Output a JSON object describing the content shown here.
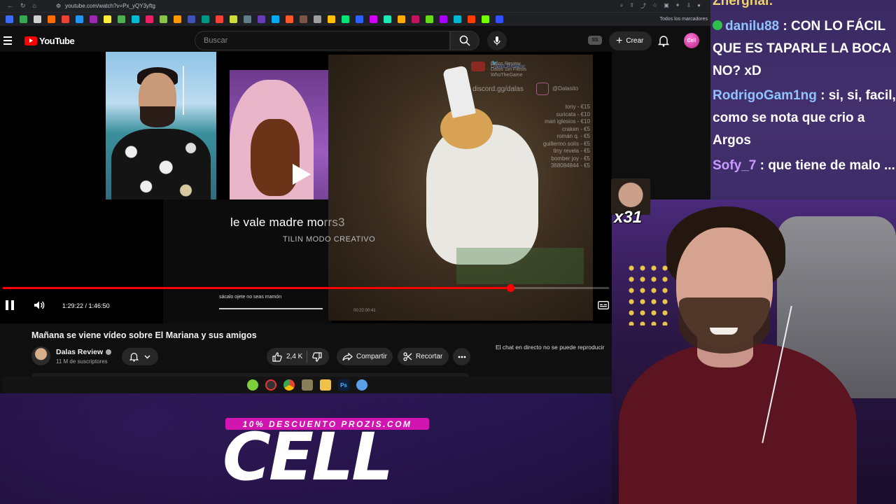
{
  "browser": {
    "url": "youtube.com/watch?v=Px_yQY3yftg",
    "bookmarks_all_label": "Todos los marcadores",
    "bookmark_colors": [
      "#3c6cf6",
      "#34a853",
      "#cfcfcf",
      "#ff6d00",
      "#ea4335",
      "#2196f3",
      "#9c27b0",
      "#ffeb3b",
      "#4caf50",
      "#00bcd4",
      "#e91e63",
      "#8bc34a",
      "#ff9800",
      "#3f51b5",
      "#009688",
      "#f44336",
      "#cddc39",
      "#607d8b",
      "#673ab7",
      "#03a9f4",
      "#ff5722",
      "#795548",
      "#9e9e9e",
      "#ffc107",
      "#00e676",
      "#2962ff",
      "#d500f9",
      "#1de9b6",
      "#ffab00",
      "#c51162",
      "#64dd17",
      "#aa00ff",
      "#00b8d4",
      "#ff3d00",
      "#76ff03",
      "#304ffe"
    ]
  },
  "youtube": {
    "logo_text": "YouTube",
    "search_placeholder": "Buscar",
    "ss_badge": "SS",
    "create_label": "Crear",
    "avatar_text": "Cell"
  },
  "player": {
    "time_current": "1:29:22",
    "time_separator": " / ",
    "time_total": "1:46:50",
    "progress": 0.837,
    "subtitle_main": "le vale madre mo",
    "subtitle_faded": "rrs3",
    "subtitle_tag": "TILIN MODO CREATIVO",
    "inner_subtitle": "sácalo ojete no seas mamón",
    "overlay": {
      "twitter": "Dalas Review",
      "youtube_line1": "Dalos Review",
      "youtube_line2": "Dalos Sin Filtros",
      "youtube_line3": "WhoTheGame",
      "discord": "discord.gg/dalas",
      "instagram": "@Dalasito",
      "donations": [
        "tony - €15",
        "suricata - €10",
        "mari iglesios - €10",
        "craken - €5",
        "román q. - €5",
        "guillermo solís - €5",
        "tiny revela - €5",
        "bomber joy - €5",
        "368084844 - €5"
      ],
      "timestamp": "00:22:00:41"
    }
  },
  "video": {
    "title": "Mañana se viene vídeo sobre El Mariana y sus amigos",
    "channel": "Dalas Review",
    "subscribers": "11 M de suscriptores",
    "likes": "2,4 K",
    "share_label": "Compartir",
    "clip_label": "Recortar",
    "live_chat_note": "El chat en directo no se puede reproducir"
  },
  "promo": {
    "badge": "10% DESCUENTO PROZIS.COM",
    "name": "CELL"
  },
  "chat": {
    "top_user": "Zherghal",
    "messages": [
      {
        "user": "danilu88",
        "color": "#8fc3ff",
        "text": "CON LO FÁCIL QUE ES TAPARLE LA BOCA NO? xD"
      },
      {
        "user": "RodrigoGam1ng",
        "color": "#8fc3ff",
        "text": "si, si, facil, como se nota que crio a Argos"
      },
      {
        "user": "Sofy_7",
        "color": "#c89bff",
        "text": "que tiene de malo ..."
      }
    ]
  },
  "emote": {
    "count": "x31"
  }
}
